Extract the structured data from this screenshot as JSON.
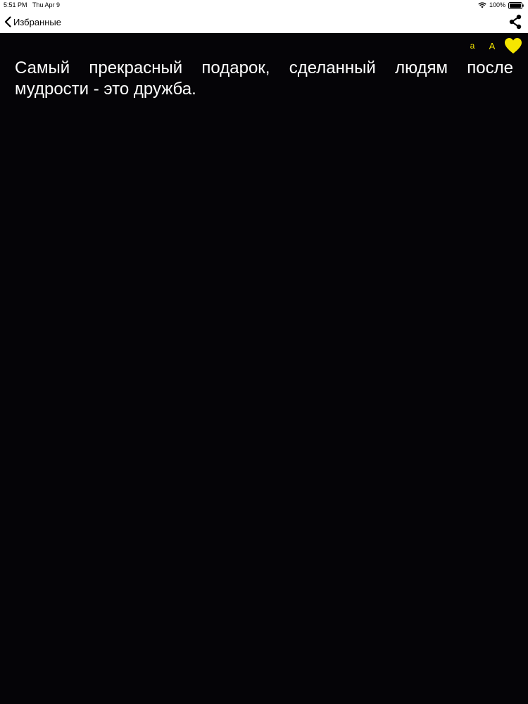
{
  "status_bar": {
    "time": "5:51 PM",
    "date": "Thu Apr 9",
    "battery": "100%"
  },
  "nav": {
    "back_label": "Избранные",
    "back_icon": "chevron-left-icon",
    "share_icon": "share-icon"
  },
  "controls": {
    "font_decrease_label": "a",
    "font_increase_label": "A",
    "favorite_icon": "heart-icon",
    "accent_color": "#f5e600"
  },
  "content": {
    "quote": "Самый прекрасный подарок, сделанный людям после мудрости - это дружба."
  },
  "colors": {
    "background": "#050407",
    "text": "#ffffff",
    "bar_background": "#ffffff"
  }
}
